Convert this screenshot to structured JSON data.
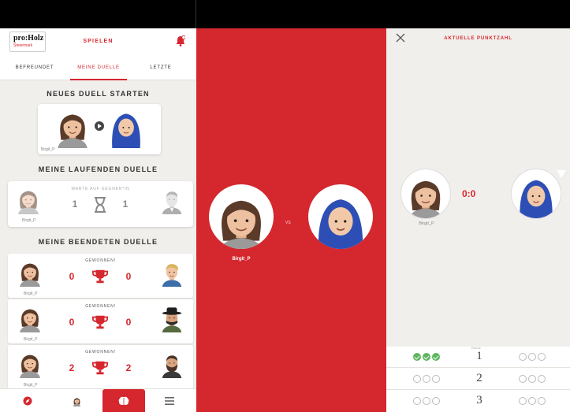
{
  "app": {
    "logo_text": "pro:Holz",
    "logo_sub": "Steiermark",
    "header_title": "SPIELEN"
  },
  "tabs": [
    {
      "label": "BEFREUNDET"
    },
    {
      "label": "MEINE DUELLE",
      "active": true
    },
    {
      "label": "LETZTE"
    }
  ],
  "new_duel": {
    "title": "NEUES DUELL STARTEN",
    "player_name": "Birgit_P"
  },
  "running": {
    "title": "MEINE LAUFENDEN DUELLE",
    "status": "WARTE AUF GEGNER*IN",
    "score_left": "1",
    "score_right": "1",
    "player_name": "Birgit_P"
  },
  "finished": {
    "title": "MEINE BEENDETEN DUELLE",
    "rows": [
      {
        "status": "GEWONNEN!",
        "score_left": "0",
        "score_right": "0",
        "player_name": "Birgit_P"
      },
      {
        "status": "GEWONNEN!",
        "score_left": "0",
        "score_right": "0",
        "player_name": "Birgit_P"
      },
      {
        "status": "GEWONNEN!",
        "score_left": "2",
        "score_right": "2",
        "player_name": "Birgit_P"
      }
    ]
  },
  "bottom_nav": [
    {
      "icon": "compass-icon"
    },
    {
      "icon": "profile-icon"
    },
    {
      "icon": "brain-icon",
      "active": true
    },
    {
      "icon": "menu-icon"
    }
  ],
  "duel_screen": {
    "vs_label": "VS",
    "player_name": "Birgit_P"
  },
  "score_screen": {
    "title": "AKTUELLE PUNKTZAHL",
    "score": "0:0",
    "player_name": "Birgit_P",
    "round_label": "Runde",
    "rounds": [
      {
        "number": "1",
        "left": [
          true,
          true,
          true
        ],
        "right": [
          false,
          false,
          false
        ]
      },
      {
        "number": "2",
        "left": [
          false,
          false,
          false
        ],
        "right": [
          false,
          false,
          false
        ]
      },
      {
        "number": "3",
        "left": [
          false,
          false,
          false
        ],
        "right": [
          false,
          false,
          false
        ]
      }
    ]
  },
  "colors": {
    "brand_red": "#d6262e",
    "panel_red": "#d5272e",
    "background": "#f1efec",
    "correct_green": "#5db65d"
  }
}
